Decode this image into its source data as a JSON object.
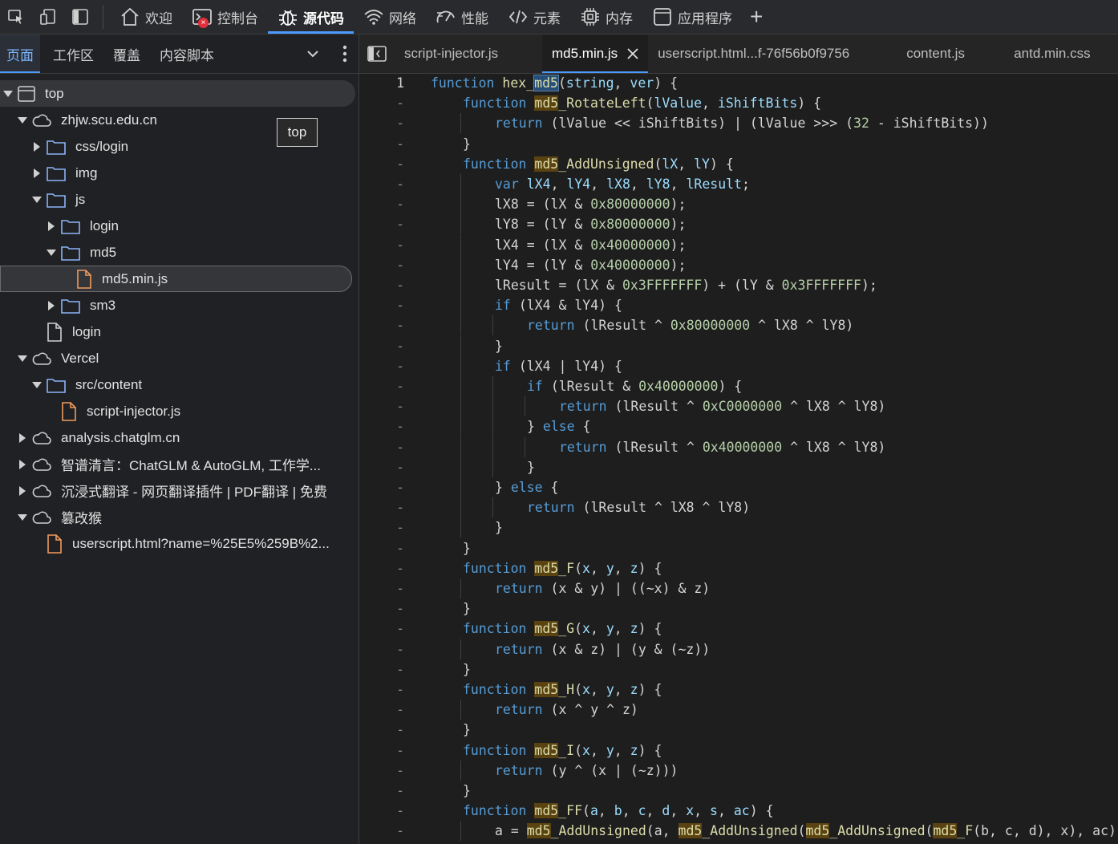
{
  "toolbar": {
    "icons": [
      "inspect-icon",
      "device-toggle-icon",
      "sidebar-toggle-icon"
    ],
    "tabs": [
      {
        "label": "欢迎",
        "icon": "home-icon"
      },
      {
        "label": "控制台",
        "icon": "console-icon"
      },
      {
        "label": "源代码",
        "icon": "bug-icon",
        "active": true
      },
      {
        "label": "网络",
        "icon": "wifi-icon"
      },
      {
        "label": "性能",
        "icon": "performance-icon"
      },
      {
        "label": "元素",
        "icon": "code-icon"
      },
      {
        "label": "内存",
        "icon": "memory-icon"
      },
      {
        "label": "应用程序",
        "icon": "application-icon"
      }
    ],
    "add": "+",
    "error_badge": "×"
  },
  "left_panel": {
    "subtabs": [
      "页面",
      "工作区",
      "覆盖",
      "内容脚本"
    ],
    "tooltip": "top",
    "tree": [
      {
        "label": "top",
        "type": "frame",
        "caret": "down",
        "indent": 0
      },
      {
        "label": "zhjw.scu.edu.cn",
        "type": "cloud",
        "caret": "down",
        "indent": 1
      },
      {
        "label": "css/login",
        "type": "folder",
        "caret": "right",
        "indent": 2
      },
      {
        "label": "img",
        "type": "folder",
        "caret": "right",
        "indent": 2
      },
      {
        "label": "js",
        "type": "folder",
        "caret": "down",
        "indent": 2
      },
      {
        "label": "login",
        "type": "folder",
        "caret": "right",
        "indent": 3
      },
      {
        "label": "md5",
        "type": "folder",
        "caret": "down",
        "indent": 3
      },
      {
        "label": "md5.min.js",
        "type": "jsfile",
        "caret": "none",
        "indent": 4,
        "selected": true
      },
      {
        "label": "sm3",
        "type": "folder",
        "caret": "right",
        "indent": 3
      },
      {
        "label": "login",
        "type": "file",
        "caret": "none",
        "indent": 2
      },
      {
        "label": "Vercel",
        "type": "cloud",
        "caret": "down",
        "indent": 1
      },
      {
        "label": "src/content",
        "type": "folder",
        "caret": "down",
        "indent": 2
      },
      {
        "label": "script-injector.js",
        "type": "jsfile",
        "caret": "none",
        "indent": 3
      },
      {
        "label": "analysis.chatglm.cn",
        "type": "cloud",
        "caret": "right",
        "indent": 1
      },
      {
        "label": "智谱清言：ChatGLM & AutoGLM, 工作学...",
        "type": "cloud",
        "caret": "right",
        "indent": 1
      },
      {
        "label": "沉浸式翻译 - 网页翻译插件 | PDF翻译 | 免费",
        "type": "cloud",
        "caret": "right",
        "indent": 1
      },
      {
        "label": "篡改猴",
        "type": "cloud",
        "caret": "down",
        "indent": 1
      },
      {
        "label": "userscript.html?name=%25E5%259B%2...",
        "type": "jsfile",
        "caret": "none",
        "indent": 2
      }
    ]
  },
  "editor": {
    "tabs": [
      {
        "label": "script-injector.js"
      },
      {
        "label": "md5.min.js",
        "active": true
      },
      {
        "label": "userscript.html...f-76f56b0f9756"
      },
      {
        "label": "content.js"
      },
      {
        "label": "antd.min.css"
      }
    ],
    "first_line_number": "1",
    "other_line_marker": "-",
    "lines": [
      {
        "i": 0,
        "seg": [
          [
            "kw",
            "function "
          ],
          [
            "fn",
            "hex_"
          ],
          [
            "fn sel-w",
            "md5"
          ],
          [
            "",
            "("
          ],
          [
            "pm",
            "string"
          ],
          [
            "",
            ", "
          ],
          [
            "pm",
            "ver"
          ],
          [
            "",
            ") {"
          ]
        ]
      },
      {
        "i": 1,
        "seg": [
          [
            "kw",
            "function "
          ],
          [
            "fn hlw",
            "md5"
          ],
          [
            "fn",
            "_RotateLeft"
          ],
          [
            "",
            "("
          ],
          [
            "pm",
            "lValue"
          ],
          [
            "",
            ", "
          ],
          [
            "pm",
            "iShiftBits"
          ],
          [
            "",
            ") {"
          ]
        ]
      },
      {
        "i": 2,
        "seg": [
          [
            "kw",
            "return "
          ],
          [
            "",
            "(lValue << iShiftBits) | (lValue >>> ("
          ],
          [
            "nm",
            "32"
          ],
          [
            "",
            " - iShiftBits))"
          ]
        ]
      },
      {
        "i": 1,
        "seg": [
          [
            "",
            "}"
          ]
        ]
      },
      {
        "i": 1,
        "seg": [
          [
            "kw",
            "function "
          ],
          [
            "fn hlw",
            "md5"
          ],
          [
            "fn",
            "_AddUnsigned"
          ],
          [
            "",
            "("
          ],
          [
            "pm",
            "lX"
          ],
          [
            "",
            ", "
          ],
          [
            "pm",
            "lY"
          ],
          [
            "",
            ") {"
          ]
        ]
      },
      {
        "i": 2,
        "seg": [
          [
            "kw",
            "var "
          ],
          [
            "vr",
            "lX4"
          ],
          [
            "",
            ", "
          ],
          [
            "vr",
            "lY4"
          ],
          [
            "",
            ", "
          ],
          [
            "vr",
            "lX8"
          ],
          [
            "",
            ", "
          ],
          [
            "vr",
            "lY8"
          ],
          [
            "",
            ", "
          ],
          [
            "vr",
            "lResult"
          ],
          [
            "",
            ";"
          ]
        ]
      },
      {
        "i": 2,
        "seg": [
          [
            "",
            "lX8 = (lX & "
          ],
          [
            "nm",
            "0x80000000"
          ],
          [
            "",
            ");"
          ]
        ]
      },
      {
        "i": 2,
        "seg": [
          [
            "",
            "lY8 = (lY & "
          ],
          [
            "nm",
            "0x80000000"
          ],
          [
            "",
            ");"
          ]
        ]
      },
      {
        "i": 2,
        "seg": [
          [
            "",
            "lX4 = (lX & "
          ],
          [
            "nm",
            "0x40000000"
          ],
          [
            "",
            ");"
          ]
        ]
      },
      {
        "i": 2,
        "seg": [
          [
            "",
            "lY4 = (lY & "
          ],
          [
            "nm",
            "0x40000000"
          ],
          [
            "",
            ");"
          ]
        ]
      },
      {
        "i": 2,
        "seg": [
          [
            "",
            "lResult = (lX & "
          ],
          [
            "nm",
            "0x3FFFFFFF"
          ],
          [
            "",
            ") + (lY & "
          ],
          [
            "nm",
            "0x3FFFFFFF"
          ],
          [
            "",
            ");"
          ]
        ]
      },
      {
        "i": 2,
        "seg": [
          [
            "kw",
            "if "
          ],
          [
            "",
            "(lX4 & lY4) {"
          ]
        ]
      },
      {
        "i": 3,
        "seg": [
          [
            "kw",
            "return "
          ],
          [
            "",
            "(lResult ^ "
          ],
          [
            "nm",
            "0x80000000"
          ],
          [
            "",
            " ^ lX8 ^ lY8)"
          ]
        ]
      },
      {
        "i": 2,
        "seg": [
          [
            "",
            "}"
          ]
        ]
      },
      {
        "i": 2,
        "seg": [
          [
            "kw",
            "if "
          ],
          [
            "",
            "(lX4 | lY4) {"
          ]
        ]
      },
      {
        "i": 3,
        "seg": [
          [
            "kw",
            "if "
          ],
          [
            "",
            "(lResult & "
          ],
          [
            "nm",
            "0x40000000"
          ],
          [
            "",
            ") {"
          ]
        ]
      },
      {
        "i": 4,
        "seg": [
          [
            "kw",
            "return "
          ],
          [
            "",
            "(lResult ^ "
          ],
          [
            "nm",
            "0xC0000000"
          ],
          [
            "",
            " ^ lX8 ^ lY8)"
          ]
        ]
      },
      {
        "i": 3,
        "seg": [
          [
            "",
            "} "
          ],
          [
            "kw",
            "else "
          ],
          [
            "",
            "{"
          ]
        ]
      },
      {
        "i": 4,
        "seg": [
          [
            "kw",
            "return "
          ],
          [
            "",
            "(lResult ^ "
          ],
          [
            "nm",
            "0x40000000"
          ],
          [
            "",
            " ^ lX8 ^ lY8)"
          ]
        ]
      },
      {
        "i": 3,
        "seg": [
          [
            "",
            "}"
          ]
        ]
      },
      {
        "i": 2,
        "seg": [
          [
            "",
            "} "
          ],
          [
            "kw",
            "else "
          ],
          [
            "",
            "{"
          ]
        ]
      },
      {
        "i": 3,
        "seg": [
          [
            "kw",
            "return "
          ],
          [
            "",
            "(lResult ^ lX8 ^ lY8)"
          ]
        ]
      },
      {
        "i": 2,
        "seg": [
          [
            "",
            "}"
          ]
        ]
      },
      {
        "i": 1,
        "seg": [
          [
            "",
            "}"
          ]
        ]
      },
      {
        "i": 1,
        "seg": [
          [
            "kw",
            "function "
          ],
          [
            "fn hlw",
            "md5"
          ],
          [
            "fn",
            "_F"
          ],
          [
            "",
            "("
          ],
          [
            "pm",
            "x"
          ],
          [
            "",
            ", "
          ],
          [
            "pm",
            "y"
          ],
          [
            "",
            ", "
          ],
          [
            "pm",
            "z"
          ],
          [
            "",
            ") {"
          ]
        ]
      },
      {
        "i": 2,
        "seg": [
          [
            "kw",
            "return "
          ],
          [
            "",
            "(x & y) | ((~x) & z)"
          ]
        ]
      },
      {
        "i": 1,
        "seg": [
          [
            "",
            "}"
          ]
        ]
      },
      {
        "i": 1,
        "seg": [
          [
            "kw",
            "function "
          ],
          [
            "fn hlw",
            "md5"
          ],
          [
            "fn",
            "_G"
          ],
          [
            "",
            "("
          ],
          [
            "pm",
            "x"
          ],
          [
            "",
            ", "
          ],
          [
            "pm",
            "y"
          ],
          [
            "",
            ", "
          ],
          [
            "pm",
            "z"
          ],
          [
            "",
            ") {"
          ]
        ]
      },
      {
        "i": 2,
        "seg": [
          [
            "kw",
            "return "
          ],
          [
            "",
            "(x & z) | (y & (~z))"
          ]
        ]
      },
      {
        "i": 1,
        "seg": [
          [
            "",
            "}"
          ]
        ]
      },
      {
        "i": 1,
        "seg": [
          [
            "kw",
            "function "
          ],
          [
            "fn hlw",
            "md5"
          ],
          [
            "fn",
            "_H"
          ],
          [
            "",
            "("
          ],
          [
            "pm",
            "x"
          ],
          [
            "",
            ", "
          ],
          [
            "pm",
            "y"
          ],
          [
            "",
            ", "
          ],
          [
            "pm",
            "z"
          ],
          [
            "",
            ") {"
          ]
        ]
      },
      {
        "i": 2,
        "seg": [
          [
            "kw",
            "return "
          ],
          [
            "",
            "(x ^ y ^ z)"
          ]
        ]
      },
      {
        "i": 1,
        "seg": [
          [
            "",
            "}"
          ]
        ]
      },
      {
        "i": 1,
        "seg": [
          [
            "kw",
            "function "
          ],
          [
            "fn hlw",
            "md5"
          ],
          [
            "fn",
            "_I"
          ],
          [
            "",
            "("
          ],
          [
            "pm",
            "x"
          ],
          [
            "",
            ", "
          ],
          [
            "pm",
            "y"
          ],
          [
            "",
            ", "
          ],
          [
            "pm",
            "z"
          ],
          [
            "",
            ") {"
          ]
        ]
      },
      {
        "i": 2,
        "seg": [
          [
            "kw",
            "return "
          ],
          [
            "",
            "(y ^ (x | (~z)))"
          ]
        ]
      },
      {
        "i": 1,
        "seg": [
          [
            "",
            "}"
          ]
        ]
      },
      {
        "i": 1,
        "seg": [
          [
            "kw",
            "function "
          ],
          [
            "fn hlw",
            "md5"
          ],
          [
            "fn",
            "_FF"
          ],
          [
            "",
            "("
          ],
          [
            "pm",
            "a"
          ],
          [
            "",
            ", "
          ],
          [
            "pm",
            "b"
          ],
          [
            "",
            ", "
          ],
          [
            "pm",
            "c"
          ],
          [
            "",
            ", "
          ],
          [
            "pm",
            "d"
          ],
          [
            "",
            ", "
          ],
          [
            "pm",
            "x"
          ],
          [
            "",
            ", "
          ],
          [
            "pm",
            "s"
          ],
          [
            "",
            ", "
          ],
          [
            "pm",
            "ac"
          ],
          [
            "",
            ") {"
          ]
        ]
      },
      {
        "i": 2,
        "seg": [
          [
            "",
            "a = "
          ],
          [
            "fn hlw",
            "md5"
          ],
          [
            "fn",
            "_AddUnsigned"
          ],
          [
            "",
            "(a, "
          ],
          [
            "fn hlw",
            "md5"
          ],
          [
            "fn",
            "_AddUnsigned"
          ],
          [
            "",
            "("
          ],
          [
            "fn hlw",
            "md5"
          ],
          [
            "fn",
            "_AddUnsigned"
          ],
          [
            "",
            "("
          ],
          [
            "fn hlw",
            "md5"
          ],
          [
            "fn",
            "_F"
          ],
          [
            "",
            "(b, c, d), x), ac))"
          ]
        ]
      }
    ]
  }
}
